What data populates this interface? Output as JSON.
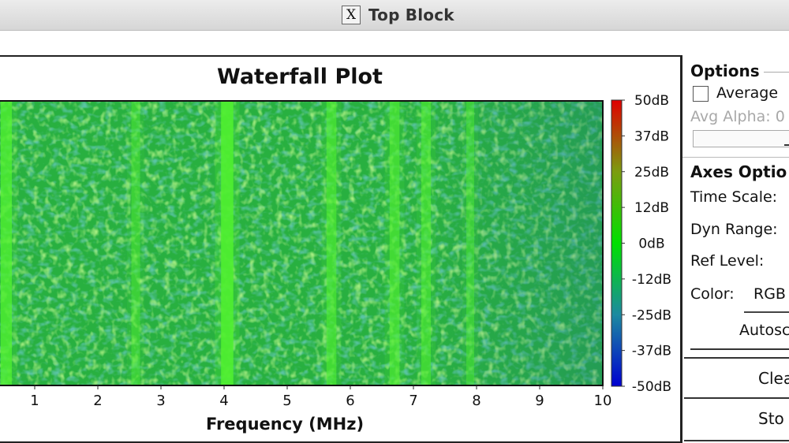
{
  "window": {
    "title": "Top Block",
    "icon": "x-window-icon"
  },
  "plot": {
    "title": "Waterfall Plot",
    "xlabel": "Frequency (MHz)"
  },
  "chart_data": {
    "type": "heatmap",
    "title": "Waterfall Plot",
    "xlabel": "Frequency (MHz)",
    "x_ticks": [
      "1",
      "2",
      "3",
      "4",
      "5",
      "6",
      "7",
      "8",
      "9",
      "10"
    ],
    "xlim": [
      0.45,
      10
    ],
    "colorbar": {
      "labels": [
        "50dB",
        "37dB",
        "25dB",
        "12dB",
        "0dB",
        "-12dB",
        "-25dB",
        "-37dB",
        "-50dB"
      ],
      "range": [
        -50,
        50
      ],
      "colormap": [
        "#0000cc",
        "#2aa0a0",
        "#00e000",
        "#c07820",
        "#e00000"
      ]
    },
    "background_level_db": -15,
    "signal_lines_mhz": [
      0.55,
      2.6,
      4.05,
      5.7,
      6.7,
      7.2,
      7.9
    ],
    "signal_strength_db": [
      0,
      -6,
      3,
      -3,
      -3,
      -4,
      -8
    ]
  },
  "colors": {
    "background": "#28b040",
    "signal": "#50f030",
    "noise_dark": "#1f7f8a",
    "noise_light": "#4ed43c"
  },
  "panel": {
    "options_title": "Options",
    "average_label": "Average",
    "average_checked": false,
    "avg_alpha_label": "Avg Alpha: 0",
    "axes_title": "Axes Optio",
    "time_scale_label": "Time Scale:",
    "dyn_range_label": "Dyn Range:",
    "ref_level_label": "Ref Level:",
    "color_label": "Color:",
    "color_value": "RGB",
    "autoscale_label": "Autosc",
    "clear_label": "Clea",
    "stop_label": "Sto"
  }
}
